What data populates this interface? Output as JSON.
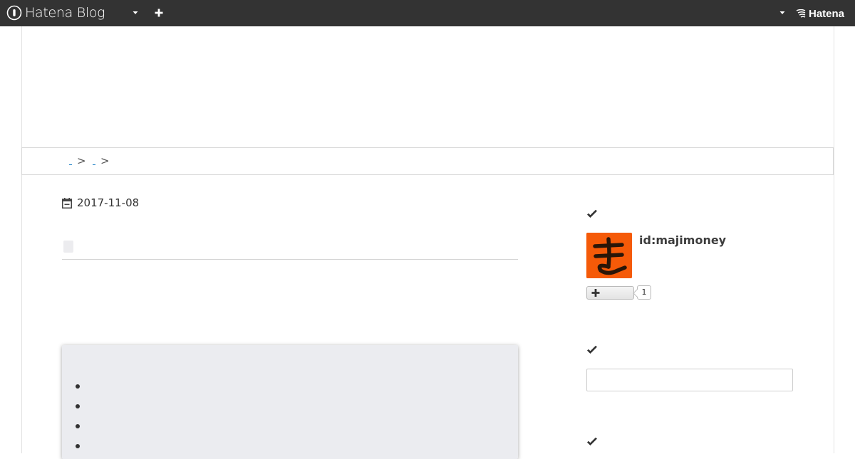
{
  "header": {
    "brand": "Hatena Blog",
    "hatena_brand": "Hatena",
    "icons": {
      "logo": "hatena-blog-logo-icon",
      "blog_menu": "caret-down-icon",
      "add": "plus-icon",
      "account_menu": "caret-down-icon",
      "hatena": "hatena-logo-icon"
    },
    "colors": {
      "bar": "#333333",
      "text": "#ffffff"
    }
  },
  "breadcrumb": {
    "separator": ">"
  },
  "entry": {
    "date": "2017-11-08",
    "icons": {
      "date": "calendar-icon"
    }
  },
  "sidebar": {
    "profile": {
      "user_id": "id:majimoney",
      "avatar_char": "ま",
      "avatar_color": "#f55a08",
      "follower_count": "1",
      "icons": {
        "heading": "check-icon",
        "follow": "plus-icon"
      }
    },
    "search": {
      "value": "",
      "icons": {
        "heading": "check-icon"
      }
    }
  }
}
